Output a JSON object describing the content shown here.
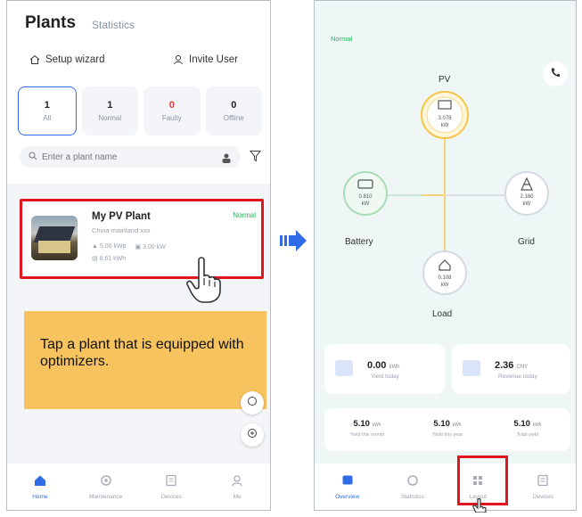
{
  "left": {
    "title": "Plants",
    "subtitle": "Statistics",
    "setup_label": "Setup wizard",
    "invite_label": "Invite User",
    "stats": [
      {
        "num": "1",
        "label": "All"
      },
      {
        "num": "1",
        "label": "Normal"
      },
      {
        "num": "0",
        "label": "Faulty"
      },
      {
        "num": "0",
        "label": "Offline"
      }
    ],
    "search_placeholder": "Enter a plant name",
    "plant": {
      "name": "My PV Plant",
      "status": "Normal",
      "address": "China mainland xxx",
      "capacity": "5.00 kWp",
      "power": "3.00 kW",
      "energy": "8.61 kWh"
    },
    "callout_text": "Tap a plant that is equipped with optimizers.",
    "tabs": [
      "Home",
      "Maintenance",
      "Devices",
      "Me"
    ]
  },
  "right": {
    "status_tag": "Normal",
    "nodes": {
      "pv": {
        "label": "PV",
        "value": "3.078",
        "unit": "kW"
      },
      "battery": {
        "label": "Battery",
        "value": "0.810",
        "unit": "kW"
      },
      "grid": {
        "label": "Grid",
        "value": "2.160",
        "unit": "kW"
      },
      "load": {
        "label": "Load",
        "value": "0.108",
        "unit": "kW"
      }
    },
    "yield_today": {
      "value": "0.00",
      "unit": "kWh",
      "label": "Yield today"
    },
    "revenue_today": {
      "value": "2.36",
      "unit": "CNY",
      "label": "Revenue today"
    },
    "totals": [
      {
        "value": "5.10",
        "unit": "kWh",
        "label": "Yield this month"
      },
      {
        "value": "5.10",
        "unit": "kWh",
        "label": "Yield this year"
      },
      {
        "value": "5.10",
        "unit": "kWh",
        "label": "Total yield"
      }
    ],
    "tabs": [
      "Overview",
      "Statistics",
      "Layout",
      "Devices"
    ]
  },
  "colors": {
    "accent": "#2f6ce5",
    "highlight": "#e0161e",
    "callout": "#f7c35f",
    "pv_node": "#f6c64a",
    "normal": "#25b05a"
  }
}
